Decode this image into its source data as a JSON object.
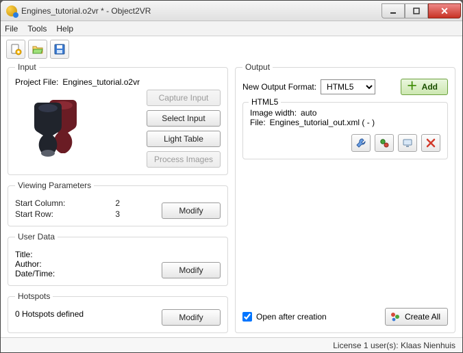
{
  "window": {
    "title": "Engines_tutorial.o2vr * - Object2VR"
  },
  "menu": {
    "file": "File",
    "tools": "Tools",
    "help": "Help"
  },
  "input": {
    "legend": "Input",
    "projectfile_label": "Project File:",
    "projectfile_value": "Engines_tutorial.o2vr",
    "btn_capture": "Capture Input",
    "btn_select": "Select Input",
    "btn_light": "Light Table",
    "btn_process": "Process Images"
  },
  "viewing": {
    "legend": "Viewing Parameters",
    "startcol_label": "Start Column:",
    "startcol_value": "2",
    "startrow_label": "Start Row:",
    "startrow_value": "3",
    "btn_modify": "Modify"
  },
  "userdata": {
    "legend": "User Data",
    "title_label": "Title:",
    "author_label": "Author:",
    "datetime_label": "Date/Time:",
    "btn_modify": "Modify"
  },
  "hotspots": {
    "legend": "Hotspots",
    "text": "0 Hotspots defined",
    "btn_modify": "Modify"
  },
  "output": {
    "legend": "Output",
    "newformat_label": "New Output Format:",
    "format_selected": "HTML5",
    "btn_add": "Add",
    "sub_legend": "HTML5",
    "imgwidth_label": "Image width:",
    "imgwidth_value": "auto",
    "file_label": "File:",
    "file_value": "Engines_tutorial_out.xml ( - )",
    "open_after": "Open after creation",
    "btn_create": "Create All"
  },
  "status": {
    "text": "License 1 user(s): Klaas Nienhuis"
  }
}
